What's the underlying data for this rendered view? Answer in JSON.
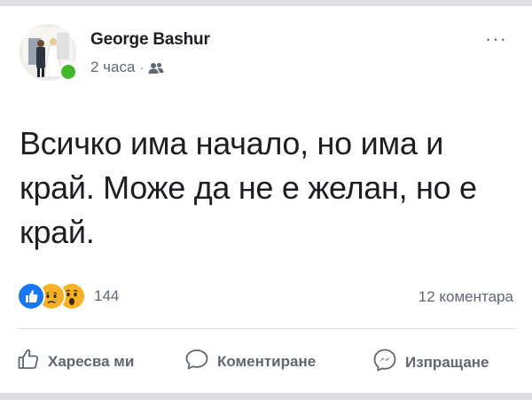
{
  "post": {
    "author": "George Bashur",
    "time": "2 часа",
    "separator": "·",
    "audience_icon": "friends-icon",
    "more_icon": "···",
    "text": "Всичко има начало, но има и край. Може да не е желан, но е край.",
    "author_online": true
  },
  "reactions": {
    "icons": [
      "like-icon",
      "sad-icon",
      "wow-icon"
    ],
    "count": "144"
  },
  "comments": {
    "count_label": "12 коментара"
  },
  "actions": {
    "like": "Харесва ми",
    "comment": "Коментиране",
    "share": "Изпращане"
  },
  "colors": {
    "text_primary": "#1c1e21",
    "text_secondary": "#606770",
    "like_blue": "#1877f2",
    "online_green": "#42b72a",
    "emoji_yellow": "#f7b125",
    "divider": "#dadde1"
  }
}
